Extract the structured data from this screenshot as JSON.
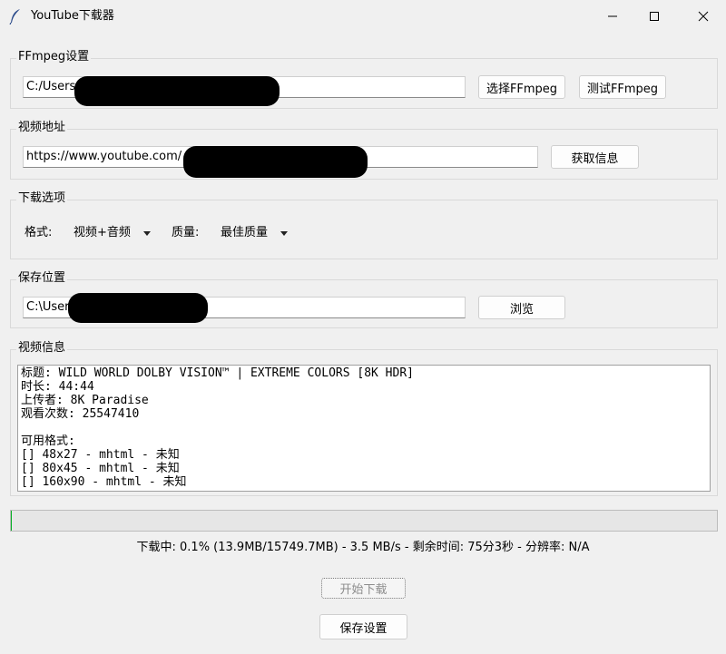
{
  "window": {
    "title": "YouTube下载器",
    "icon": "feather-icon"
  },
  "ffmpeg": {
    "label": "FFmpeg设置",
    "path_value": "C:/Users",
    "select_button": "选择FFmpeg",
    "test_button": "测试FFmpeg"
  },
  "video_url": {
    "label": "视频地址",
    "url_value": "https://www.youtube.com/",
    "fetch_button": "获取信息"
  },
  "download_options": {
    "label": "下载选项",
    "format_label": "格式:",
    "format_value": "视频+音频",
    "quality_label": "质量:",
    "quality_value": "最佳质量"
  },
  "save_location": {
    "label": "保存位置",
    "path_value": "C:\\User",
    "browse_button": "浏览"
  },
  "video_info": {
    "label": "视频信息",
    "lines": [
      "标题: WILD WORLD DOLBY VISION™ | EXTREME COLORS [8K HDR]",
      "时长: 44:44",
      "上传者: 8K Paradise",
      "观看次数: 25547410",
      "",
      "可用格式:",
      "[] 48x27 - mhtml - 未知",
      "[] 80x45 - mhtml - 未知",
      "[] 160x90 - mhtml - 未知"
    ]
  },
  "progress": {
    "percent": 0.1,
    "fill_color": "#06b025"
  },
  "status_text": "下载中: 0.1% (13.9MB/15749.7MB) - 3.5 MB/s - 剩余时间: 75分3秒 - 分辨率: N/A",
  "actions": {
    "start_button": "开始下载",
    "save_settings_button": "保存设置"
  }
}
